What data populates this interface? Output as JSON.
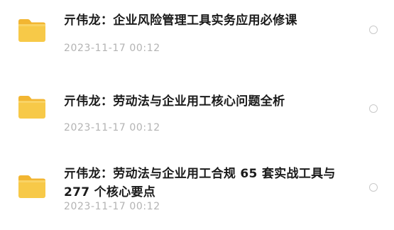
{
  "files": [
    {
      "icon": "folder-icon",
      "title": "亓伟龙：企业风险管理工具实务应用必修课",
      "timestamp": "2023-11-17 00:12"
    },
    {
      "icon": "folder-icon",
      "title": "亓伟龙：劳动法与企业用工核心问题全析",
      "timestamp": "2023-11-17 00:12"
    },
    {
      "icon": "folder-icon",
      "title": "亓伟龙：劳动法与企业用工合规 65 套实战工具与 277 个核心要点",
      "timestamp": "2023-11-17 00:12"
    }
  ],
  "colors": {
    "folder_body": "#f7c948",
    "folder_tab": "#f2b632",
    "title_text": "#1b1b1b",
    "timestamp_text": "#b3b3b3",
    "radio_border": "#c9c9c9"
  }
}
